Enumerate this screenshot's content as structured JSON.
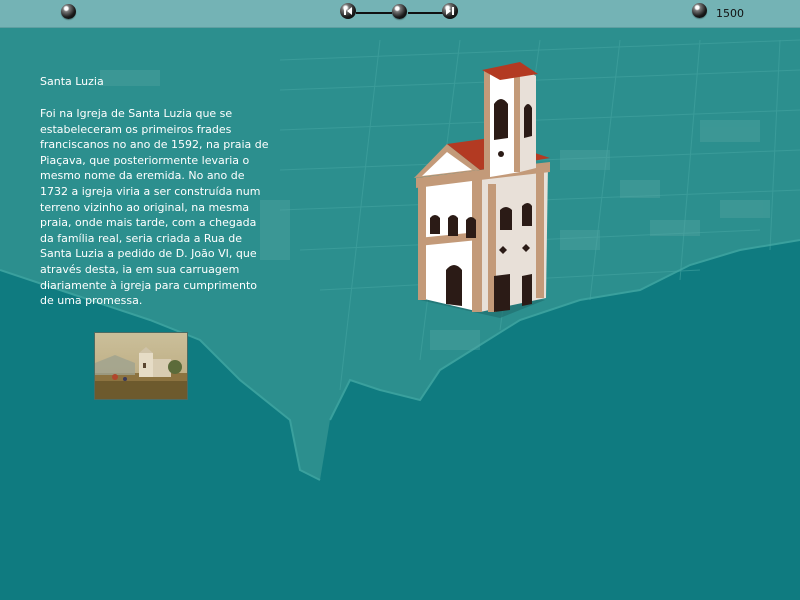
{
  "toolbar": {
    "year_label": "1500",
    "buttons": {
      "menu": "menu-ball-icon",
      "prev": "step-back-icon",
      "current": "timeline-marker-icon",
      "next": "step-forward-icon",
      "year_marker": "year-ball-icon"
    }
  },
  "content": {
    "title": "Santa Luzia",
    "body": "Foi na Igreja de Santa Luzia que se estabeleceram os primeiros frades franciscanos no ano de 1592, na praia de Piaçava, que posteriormente levaria o mesmo nome da eremida. No ano de 1732 a igreja viria a ser construída num terreno vizinho ao original, na mesma praia, onde mais tarde, com a chegada da família real, seria criada a Rua de Santa Luzia a pedido de D. João VI, que através desta, ia em sua carruagem diariamente à igreja para cumprimento de uma promessa."
  },
  "colors": {
    "sea": "#0f7b80",
    "land": "#2f9190",
    "toolbar": "#74b3b5",
    "church_wall": "#ffffff",
    "church_trim": "#c39a79",
    "roof": "#b33a22"
  }
}
